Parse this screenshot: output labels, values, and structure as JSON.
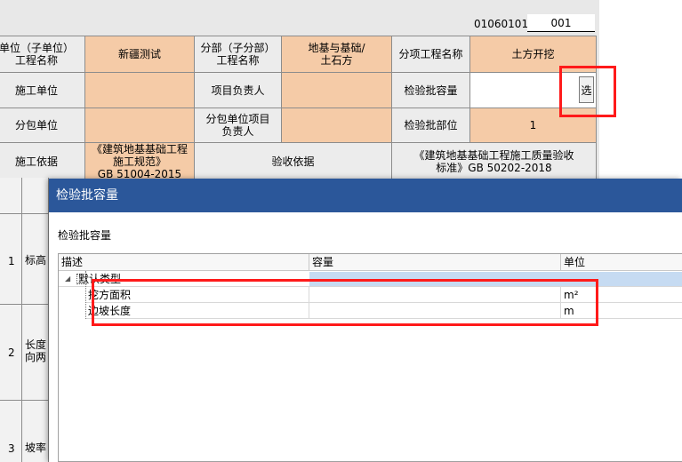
{
  "header": {
    "code_label": "01060101",
    "code_value": "001"
  },
  "form": {
    "row1": {
      "unit_project_label": "单位（子单位）\n工程名称",
      "unit_project_value": "新疆测试",
      "sub_project_label": "分部（子分部）\n工程名称",
      "sub_project_value": "地基与基础/\n土石方",
      "item_project_label": "分项工程名称",
      "item_project_value": "土方开挖"
    },
    "row2": {
      "construction_unit_label": "施工单位",
      "construction_unit_value": "",
      "project_manager_label": "项目负责人",
      "project_manager_value": "",
      "batch_capacity_label": "检验批容量",
      "batch_capacity_value": "",
      "select_button_label": "选"
    },
    "row3": {
      "subcontract_unit_label": "分包单位",
      "subcontract_unit_value": "",
      "subcontract_manager_label": "分包单位项目\n负责人",
      "subcontract_manager_value": "",
      "batch_location_label": "检验批部位",
      "batch_location_value": "1"
    },
    "row4": {
      "construction_basis_label": "施工依据",
      "construction_basis_value": "《建筑地基基础工程施工规范》\nGB 51004-2015",
      "acceptance_basis_label": "验收依据",
      "acceptance_basis_value": "《建筑地基基础工程施工质量验收\n标准》GB 50202-2018"
    }
  },
  "lower_rows": [
    {
      "num": "1",
      "text": "标高"
    },
    {
      "num": "2",
      "text": "长度\n向两"
    },
    {
      "num": "3",
      "text": "坡率"
    }
  ],
  "dialog": {
    "title": "检验批容量",
    "caption": "检验批容量",
    "columns": [
      "描述",
      "容量",
      "单位"
    ],
    "group_label": "默认类型",
    "items": [
      {
        "desc": "挖方面积",
        "capacity": "",
        "unit": "m²"
      },
      {
        "desc": "边坡长度",
        "capacity": "",
        "unit": "m"
      }
    ]
  }
}
